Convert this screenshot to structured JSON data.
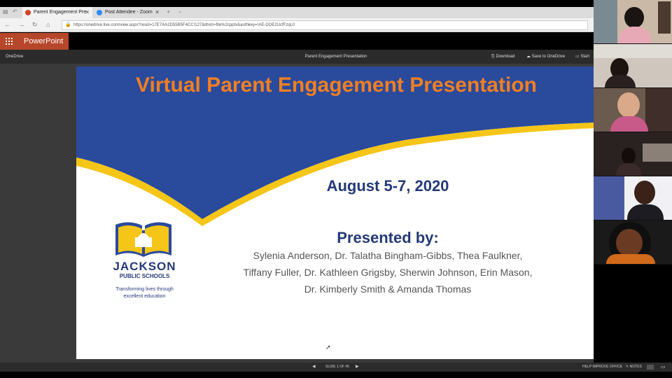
{
  "browser": {
    "tabs": [
      {
        "label": "Parent Engagement Pre",
        "active": true
      },
      {
        "label": "Post Attendee - Zoom",
        "active": false
      }
    ],
    "url": "https://onedrive.live.com/view.aspx?resid=17E7AA2D55B5F4CC!127&ithint=file%2cpptx&authkey=!AE-DOE2UcfFzqL0"
  },
  "app": {
    "name": "PowerPoint",
    "breadcrumb": "OneDrive",
    "doc_title": "Parent Engagement Presentation",
    "actions": {
      "download": "Download",
      "save": "Save to OneDrive",
      "start": "Start"
    }
  },
  "slide": {
    "title": "Virtual Parent Engagement Presentation",
    "dates": "August 5-7, 2020",
    "presented_by": "Presented by:",
    "names": [
      "Sylenia Anderson, Dr. Talatha Bingham-Gibbs, Thea Faulkner,",
      "Tiffany Fuller, Dr. Kathleen Grigsby, Sherwin Johnson, Erin Mason,",
      "Dr. Kimberly Smith & Amanda Thomas"
    ],
    "logo": {
      "name": "JACKSON",
      "sub": "PUBLIC SCHOOLS",
      "tagline1": "Transforming lives through",
      "tagline2": "excellent education"
    }
  },
  "status": {
    "slide_counter": "SLIDE 1 OF 45",
    "help": "HELP IMPROVE OFFICE",
    "notes": "NOTES"
  },
  "colors": {
    "ppt_brand": "#b7472a",
    "title_orange": "#f07f23",
    "navy": "#243a7a",
    "gold": "#f5c518"
  },
  "zoom": {
    "participants": 6
  }
}
